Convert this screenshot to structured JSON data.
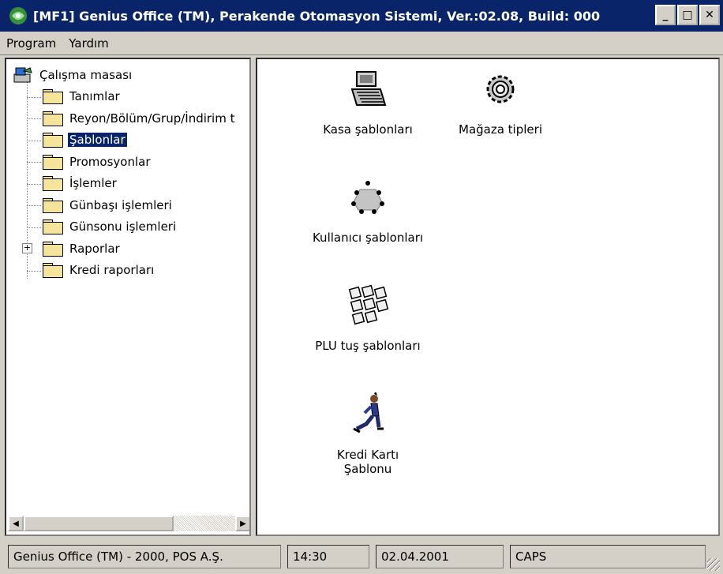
{
  "window": {
    "title": "[MF1] Genius Office (TM), Perakende Otomasyon Sistemi, Ver.:02.08, Build: 000",
    "minimize_glyph": "_",
    "maximize_glyph": "□",
    "close_glyph": "✕"
  },
  "menu": {
    "items": [
      "Program",
      "Yardım"
    ]
  },
  "tree": {
    "root": "Çalışma masası",
    "items": [
      "Tanımlar",
      "Reyon/Bölüm/Grup/İndirim t",
      "Şablonlar",
      "Promosyonlar",
      "İşlemler",
      "Günbaşı işlemleri",
      "Günsonu işlemleri",
      "Raporlar",
      "Kredi raporları"
    ],
    "selected": "Şablonlar",
    "expander": "+"
  },
  "icons": {
    "items": [
      {
        "label": "Kasa şablonları",
        "icon": "cash-register-icon"
      },
      {
        "label": "Mağaza tipleri",
        "icon": "gear-icon"
      },
      {
        "label": "Kullanıcı şablonları",
        "icon": "users-icon"
      },
      {
        "label": "PLU tuş şablonları",
        "icon": "keyboard-keys-icon"
      },
      {
        "label": "Kredi Kartı Şablonu",
        "label_line1": "Kredi Kartı",
        "label_line2": "Şablonu",
        "icon": "runner-icon"
      }
    ]
  },
  "status": {
    "company": "Genius Office (TM) - 2000, POS A.Ş.",
    "time": "14:30",
    "date": "02.04.2001",
    "caps": "CAPS"
  },
  "colors": {
    "titlebar": "#0a246a",
    "face": "#d4d0c8",
    "selection": "#0a246a"
  }
}
